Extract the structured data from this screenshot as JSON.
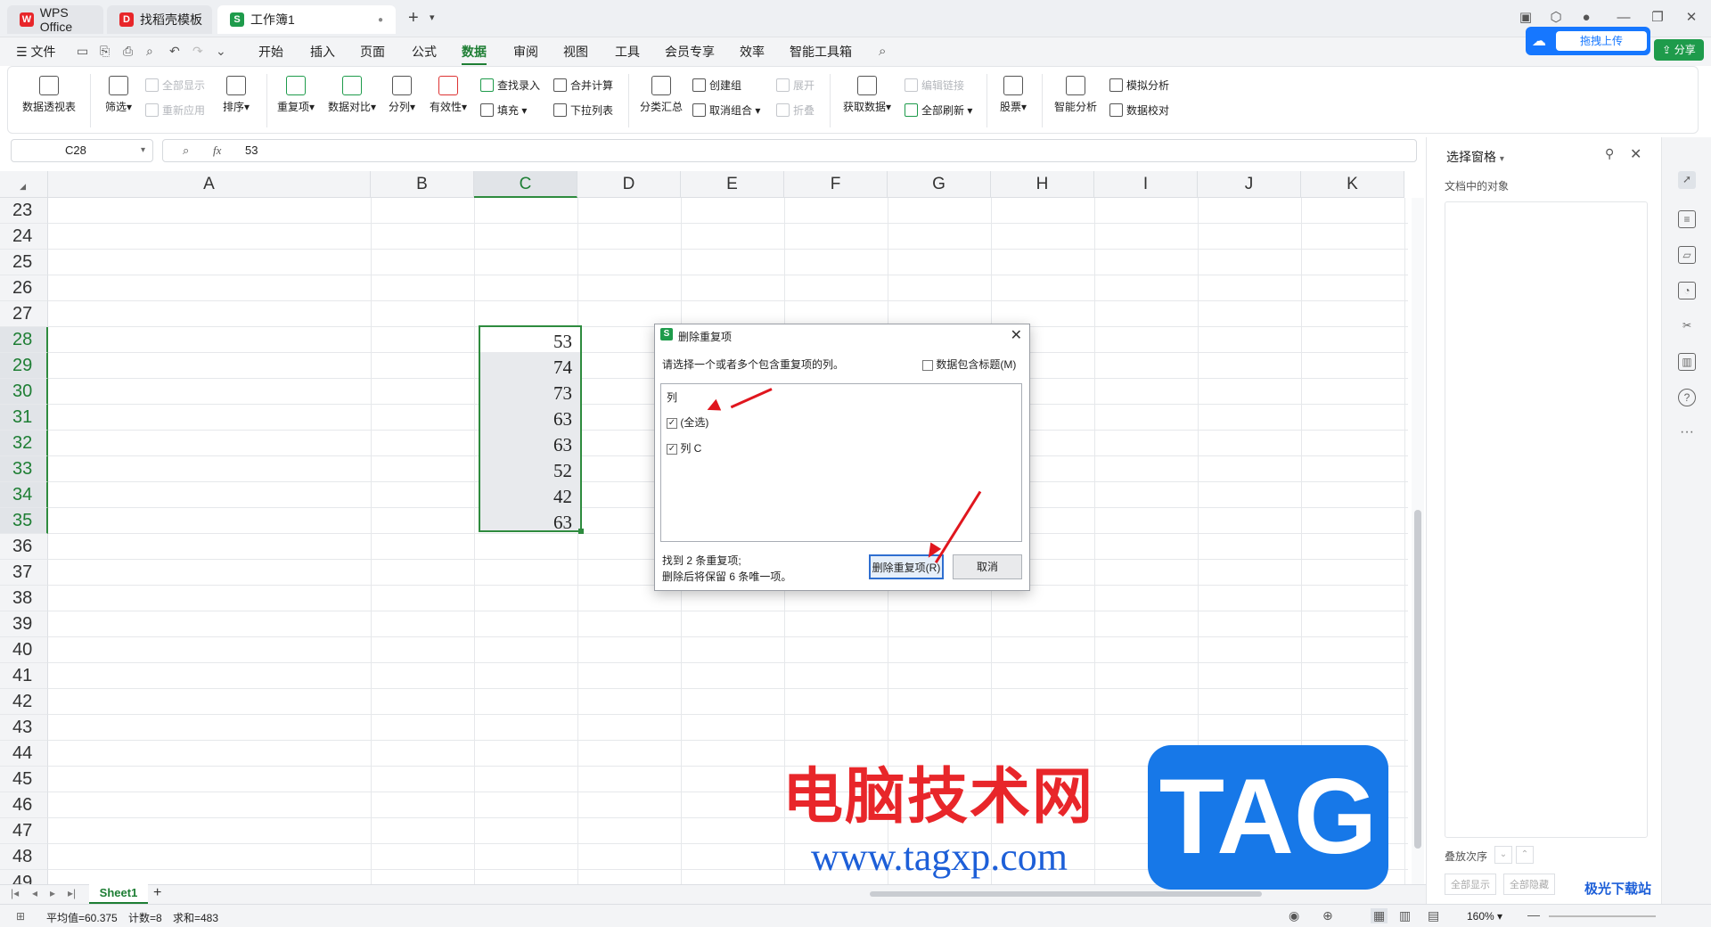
{
  "titlebar": {
    "tabs": [
      {
        "label": "WPS Office",
        "icon": "wps-logo-icon"
      },
      {
        "label": "找稻壳模板",
        "icon": "docer-icon"
      },
      {
        "label": "工作簿1",
        "icon": "sheet-doc-icon"
      }
    ],
    "new_tab": "+",
    "upload_label": "拖拽上传"
  },
  "menubar": {
    "file": "文件",
    "items": [
      "开始",
      "插入",
      "页面",
      "公式",
      "数据",
      "审阅",
      "视图",
      "工具",
      "会员专享",
      "效率",
      "智能工具箱"
    ],
    "active": "数据",
    "share": "分享"
  },
  "ribbon": {
    "pivot": "数据透视表",
    "filter": "筛选",
    "show_all": "全部显示",
    "reapply": "重新应用",
    "sort": "排序",
    "duplicates": "重复项",
    "compare": "数据对比",
    "split": "分列",
    "validity": "有效性",
    "lookup": "查找录入",
    "fill": "填充",
    "consolidate": "合并计算",
    "dropdown": "下拉列表",
    "subtotal": "分类汇总",
    "group": "创建组",
    "ungroup": "取消组合",
    "expand": "展开",
    "collapse": "折叠",
    "get_data": "获取数据",
    "edit_links": "编辑链接",
    "refresh_all": "全部刷新",
    "stocks": "股票",
    "smart": "智能分析",
    "simulate": "模拟分析",
    "verify": "数据校对"
  },
  "formula": {
    "cell_ref": "C28",
    "fx": "fx",
    "value": "53"
  },
  "grid": {
    "columns": [
      "A",
      "B",
      "C",
      "D",
      "E",
      "F",
      "G",
      "H",
      "I",
      "J",
      "K"
    ],
    "rows": [
      "23",
      "24",
      "25",
      "26",
      "27",
      "28",
      "29",
      "30",
      "31",
      "32",
      "33",
      "34",
      "35",
      "36",
      "37",
      "38",
      "39",
      "40",
      "41",
      "42",
      "43",
      "44",
      "45",
      "46",
      "47",
      "48",
      "49"
    ],
    "c_values": [
      "53",
      "74",
      "73",
      "63",
      "63",
      "52",
      "42",
      "63"
    ]
  },
  "dialog": {
    "icon": "S",
    "title": "删除重复项",
    "instruction": "请选择一个或者多个包含重复项的列。",
    "header_checkbox": "数据包含标题(M)",
    "list_header": "列",
    "items": [
      "(全选)",
      "列 C"
    ],
    "found": "找到 2 条重复项;",
    "keep": "删除后将保留 6 条唯一项。",
    "delete_button": "删除重复项(R)",
    "cancel_button": "取消"
  },
  "pane": {
    "title": "选择窗格",
    "subtitle": "文档中的对象",
    "order": "叠放次序",
    "show_all": "全部显示",
    "hide_all": "全部隐藏"
  },
  "sheetbar": {
    "sheet": "Sheet1",
    "add": "+"
  },
  "status": {
    "average": "平均值=60.375",
    "count": "计数=8",
    "sum": "求和=483",
    "zoom": "160%"
  },
  "watermark": {
    "title": "电脑技术网",
    "url": "www.tagxp.com",
    "logo": "TAG",
    "corner": "极光下载站"
  },
  "colors": {
    "accent_green": "#1e7e34",
    "selection_border": "#2e8b3e",
    "upload_blue": "#1677ff",
    "arrow_red": "#e0161e"
  }
}
